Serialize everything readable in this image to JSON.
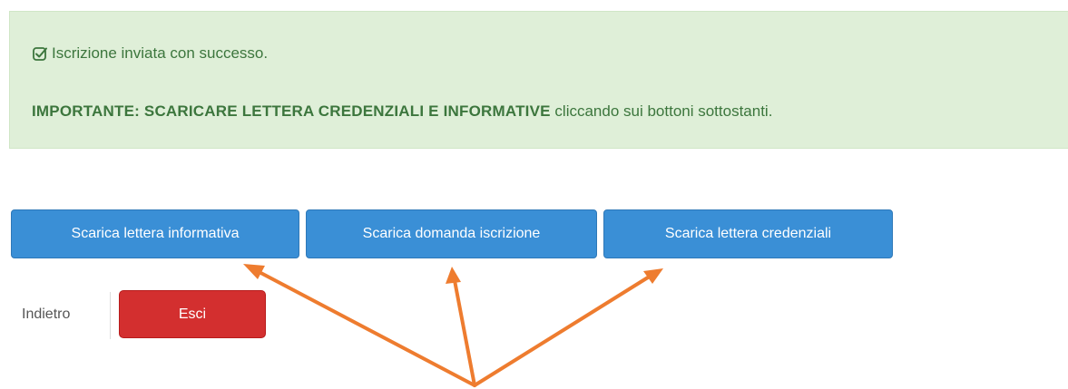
{
  "alert": {
    "success_text": "Iscrizione inviata con successo.",
    "important_bold": "IMPORTANTE: SCARICARE LETTERA CREDENZIALI E INFORMATIVE",
    "important_rest": " cliccando sui bottoni sottostanti.",
    "icon": "check-square-icon"
  },
  "buttons": {
    "informativa": "Scarica lettera informativa",
    "domanda": "Scarica domanda iscrizione",
    "credenziali": "Scarica lettera credenziali"
  },
  "footer": {
    "back_label": "Indietro",
    "exit_label": "Esci"
  },
  "colors": {
    "alert_bg": "#dfefd8",
    "alert_text": "#3c763d",
    "primary": "#3a8fd6",
    "danger": "#d32f2f",
    "annotation_arrow": "#ee7c2f"
  }
}
